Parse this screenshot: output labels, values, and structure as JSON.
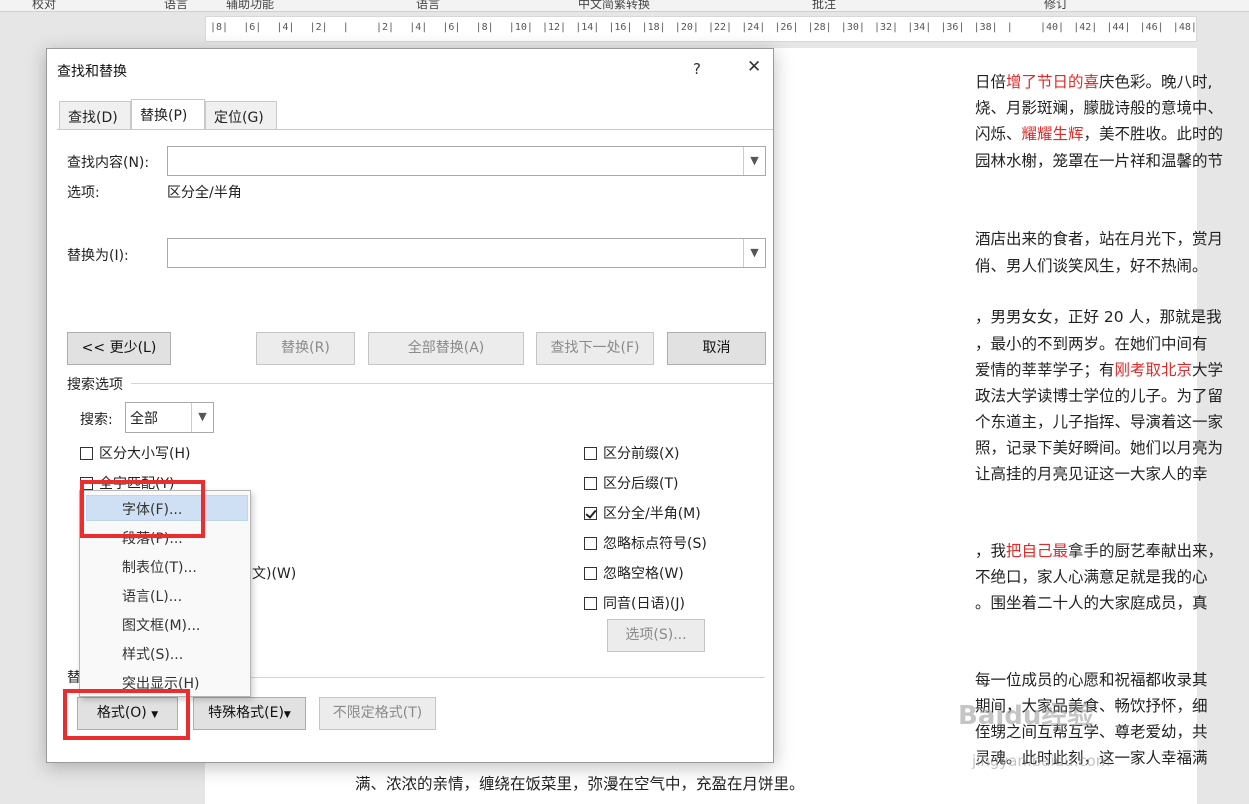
{
  "top_ribbon": [
    "校对",
    "语言",
    "辅助功能",
    "语言",
    "中文简繁转换",
    "批注",
    "修订"
  ],
  "ruler_ticks": [
    "8",
    "6",
    "4",
    "2",
    "",
    "2",
    "4",
    "6",
    "8",
    "10",
    "12",
    "14",
    "16",
    "18",
    "20",
    "22",
    "24",
    "26",
    "28",
    "30",
    "32",
    "34",
    "36",
    "38",
    "",
    "40",
    "42",
    "44",
    "46",
    "48"
  ],
  "document_lines": [
    {
      "parts": [
        {
          "t": "日倍"
        },
        {
          "t": "增了节日的喜",
          "red": true
        },
        {
          "t": "庆色彩。晚八时,"
        }
      ]
    },
    {
      "parts": [
        {
          "t": "烧、月影斑斓，朦胧诗般的意境中、"
        }
      ]
    },
    {
      "parts": [
        {
          "t": "闪烁、"
        },
        {
          "t": "耀耀生辉",
          "red": true
        },
        {
          "t": "，美不胜收。此时的"
        }
      ]
    },
    {
      "parts": [
        {
          "t": "园林水榭，笼罩在一片祥和温馨的节"
        }
      ]
    },
    {
      "parts": [
        {
          "t": "酒店出来的食者，站在月光下，赏月"
        }
      ]
    },
    {
      "parts": [
        {
          "t": "俏、男人们谈笑风生，好不热闹。"
        }
      ]
    },
    {
      "parts": [
        {
          "t": "，男男女女，正好 20 人，那就是我"
        }
      ]
    },
    {
      "parts": [
        {
          "t": "，最小的不到两岁。在她们中间有"
        }
      ]
    },
    {
      "parts": [
        {
          "t": "爱情的莘莘学子；有"
        },
        {
          "t": "刚考取北京",
          "red": true
        },
        {
          "t": "大学"
        }
      ]
    },
    {
      "parts": [
        {
          "t": "政法大学读博士学位的儿子。为了留"
        }
      ]
    },
    {
      "parts": [
        {
          "t": "个东道主，儿子指挥、导演着这一家"
        }
      ]
    },
    {
      "parts": [
        {
          "t": "照，记录下美好瞬间。她们以月亮为"
        }
      ]
    },
    {
      "parts": [
        {
          "t": "让高挂的月亮见证这一大家人的幸"
        }
      ]
    },
    {
      "parts": [
        {
          "t": "，我"
        },
        {
          "t": "把自己最",
          "red": true
        },
        {
          "t": "拿手的厨艺奉献出来，"
        }
      ]
    },
    {
      "parts": [
        {
          "t": "不绝口，家人心满意足就是我的心"
        }
      ]
    },
    {
      "parts": [
        {
          "t": "。围坐着二十人的大家庭成员，真"
        }
      ]
    },
    {
      "parts": [
        {
          "t": "每一位成员的心愿和祝福都收录其"
        }
      ]
    },
    {
      "parts": [
        {
          "t": "期间，大家品美食、畅饮抒怀，细"
        }
      ]
    },
    {
      "parts": [
        {
          "t": "侄甥之间互帮互学、尊老爱幼，共"
        }
      ]
    },
    {
      "parts": [
        {
          "t": "灵魂。此时此刻，这一家人幸福满"
        }
      ]
    },
    {
      "parts": [
        {
          "t": "满、浓浓的亲情，缠绕在饭菜里，弥漫在空气中，充盈在月饼里。"
        }
      ]
    }
  ],
  "dialog": {
    "title": "查找和替换",
    "help": "?",
    "close": "✕",
    "tabs": [
      "查找(D)",
      "替换(P)",
      "定位(G)"
    ],
    "find_label": "查找内容(N):",
    "find_value": "",
    "options_label": "选项:",
    "options_value": "区分全/半角",
    "replace_label": "替换为(I):",
    "replace_value": "",
    "btn_less": "<< 更少(L)",
    "btn_replace": "替换(R)",
    "btn_replace_all": "全部替换(A)",
    "btn_find_next": "查找下一处(F)",
    "btn_cancel": "取消",
    "search_options": "搜索选项",
    "search_label": "搜索:",
    "search_value": "全部",
    "cb_left": [
      {
        "label": "区分大小写(H)",
        "checked": false
      },
      {
        "label": "全字匹配(Y)",
        "checked": false
      }
    ],
    "cb_left_partial": "文)(W)",
    "cb_right": [
      {
        "label": "区分前缀(X)",
        "checked": false
      },
      {
        "label": "区分后缀(T)",
        "checked": false
      },
      {
        "label": "区分全/半角(M)",
        "checked": true
      },
      {
        "label": "忽略标点符号(S)",
        "checked": false
      },
      {
        "label": "忽略空格(W)",
        "checked": false
      },
      {
        "label": "同音(日语)(J)",
        "checked": false
      }
    ],
    "btn_options": "选项(S)...",
    "replace_section": "替",
    "btn_format": "格式(O)",
    "btn_special": "特殊格式(E)",
    "btn_no_format": "不限定格式(T)"
  },
  "format_menu": [
    "字体(F)...",
    "段落(P)...",
    "制表位(T)...",
    "语言(L)...",
    "图文框(M)...",
    "样式(S)...",
    "突出显示(H)"
  ],
  "watermark": {
    "brand": "Baidu经验",
    "url": "jingyan.baidu.com"
  }
}
